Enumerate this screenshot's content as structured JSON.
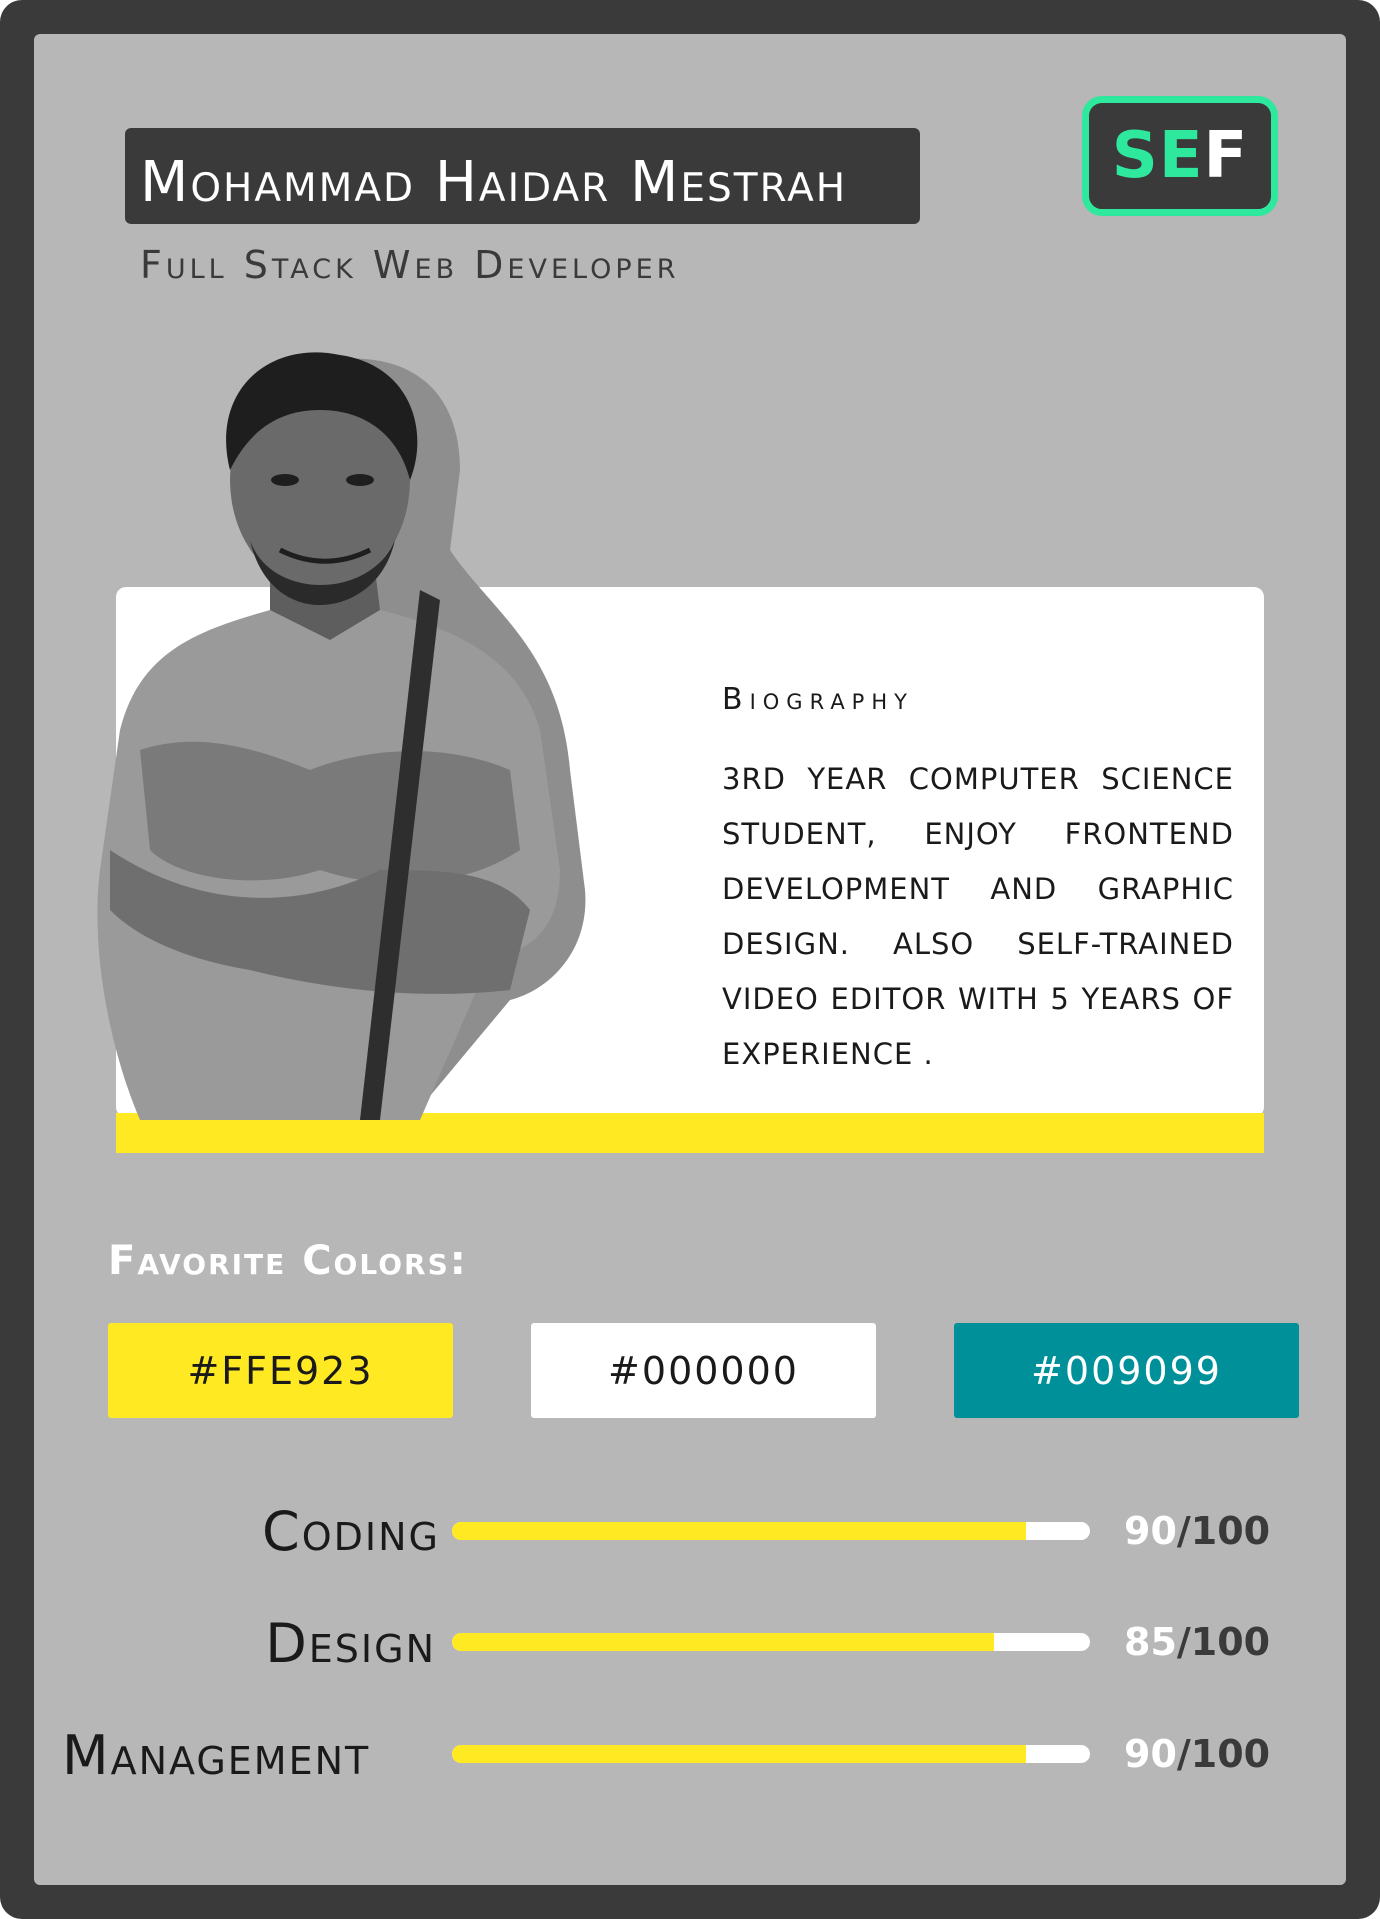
{
  "header": {
    "name": "Mohammad Haidar Mestrah",
    "role": "Full Stack Web Developer",
    "logo": {
      "part1": "SE",
      "part2": "F",
      "accent_color": "#2ee89d"
    }
  },
  "biography": {
    "title": "Biography",
    "text": "3RD YEAR COMPUTER SCIENCE STUDENT, ENJOY FRONTEND DEVELOPMENT AND GRAPHIC DESIGN. ALSO SELF-TRAINED VIDEO EDITOR WITH 5 YEARS OF EXPERIENCE ."
  },
  "favorite_colors": {
    "title": "Favorite Colors:",
    "items": [
      {
        "label": "#FFE923",
        "background": "#ffe923",
        "text_color": "#1a1a1a"
      },
      {
        "label": "#000000",
        "background": "#ffffff",
        "text_color": "#1a1a1a"
      },
      {
        "label": "#009099",
        "background": "#009099",
        "text_color": "#ffffff"
      }
    ]
  },
  "skills": [
    {
      "name": "Coding",
      "value": "90",
      "max": "/100",
      "fraction": 0.9
    },
    {
      "name": "Design",
      "value": "85",
      "max": "/100",
      "fraction": 0.85
    },
    {
      "name": "Management",
      "value": "90",
      "max": "/100",
      "fraction": 0.9
    }
  ],
  "colors": {
    "frame": "#3a3a3a",
    "card": "#b7b7b7",
    "accent_yellow": "#ffe923"
  }
}
